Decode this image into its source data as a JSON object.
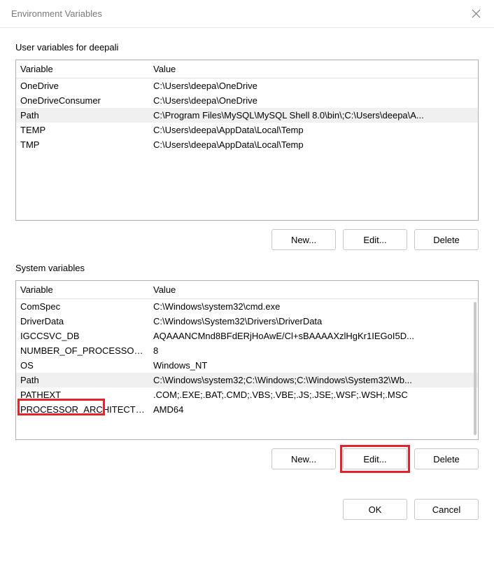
{
  "window": {
    "title": "Environment Variables"
  },
  "user_section": {
    "label": "User variables for deepali",
    "col_variable": "Variable",
    "col_value": "Value",
    "rows": [
      {
        "name": "OneDrive",
        "value": "C:\\Users\\deepa\\OneDrive",
        "selected": false
      },
      {
        "name": "OneDriveConsumer",
        "value": "C:\\Users\\deepa\\OneDrive",
        "selected": false
      },
      {
        "name": "Path",
        "value": "C:\\Program Files\\MySQL\\MySQL Shell 8.0\\bin\\;C:\\Users\\deepa\\A...",
        "selected": true
      },
      {
        "name": "TEMP",
        "value": "C:\\Users\\deepa\\AppData\\Local\\Temp",
        "selected": false
      },
      {
        "name": "TMP",
        "value": "C:\\Users\\deepa\\AppData\\Local\\Temp",
        "selected": false
      }
    ],
    "buttons": {
      "new": "New...",
      "edit": "Edit...",
      "delete": "Delete"
    }
  },
  "system_section": {
    "label": "System variables",
    "col_variable": "Variable",
    "col_value": "Value",
    "rows": [
      {
        "name": "ComSpec",
        "value": "C:\\Windows\\system32\\cmd.exe",
        "selected": false
      },
      {
        "name": "DriverData",
        "value": "C:\\Windows\\System32\\Drivers\\DriverData",
        "selected": false
      },
      {
        "name": "IGCCSVC_DB",
        "value": "AQAAANCMnd8BFdERjHoAwE/Cl+sBAAAAXzlHgKr1IEGoI5D...",
        "selected": false
      },
      {
        "name": "NUMBER_OF_PROCESSORS",
        "value": "8",
        "selected": false
      },
      {
        "name": "OS",
        "value": "Windows_NT",
        "selected": false
      },
      {
        "name": "Path",
        "value": "C:\\Windows\\system32;C:\\Windows;C:\\Windows\\System32\\Wb...",
        "selected": true
      },
      {
        "name": "PATHEXT",
        "value": ".COM;.EXE;.BAT;.CMD;.VBS;.VBE;.JS;.JSE;.WSF;.WSH;.MSC",
        "selected": false
      },
      {
        "name": "PROCESSOR_ARCHITECTU...",
        "value": "AMD64",
        "selected": false
      }
    ],
    "buttons": {
      "new": "New...",
      "edit": "Edit...",
      "delete": "Delete"
    }
  },
  "dialog_buttons": {
    "ok": "OK",
    "cancel": "Cancel"
  }
}
